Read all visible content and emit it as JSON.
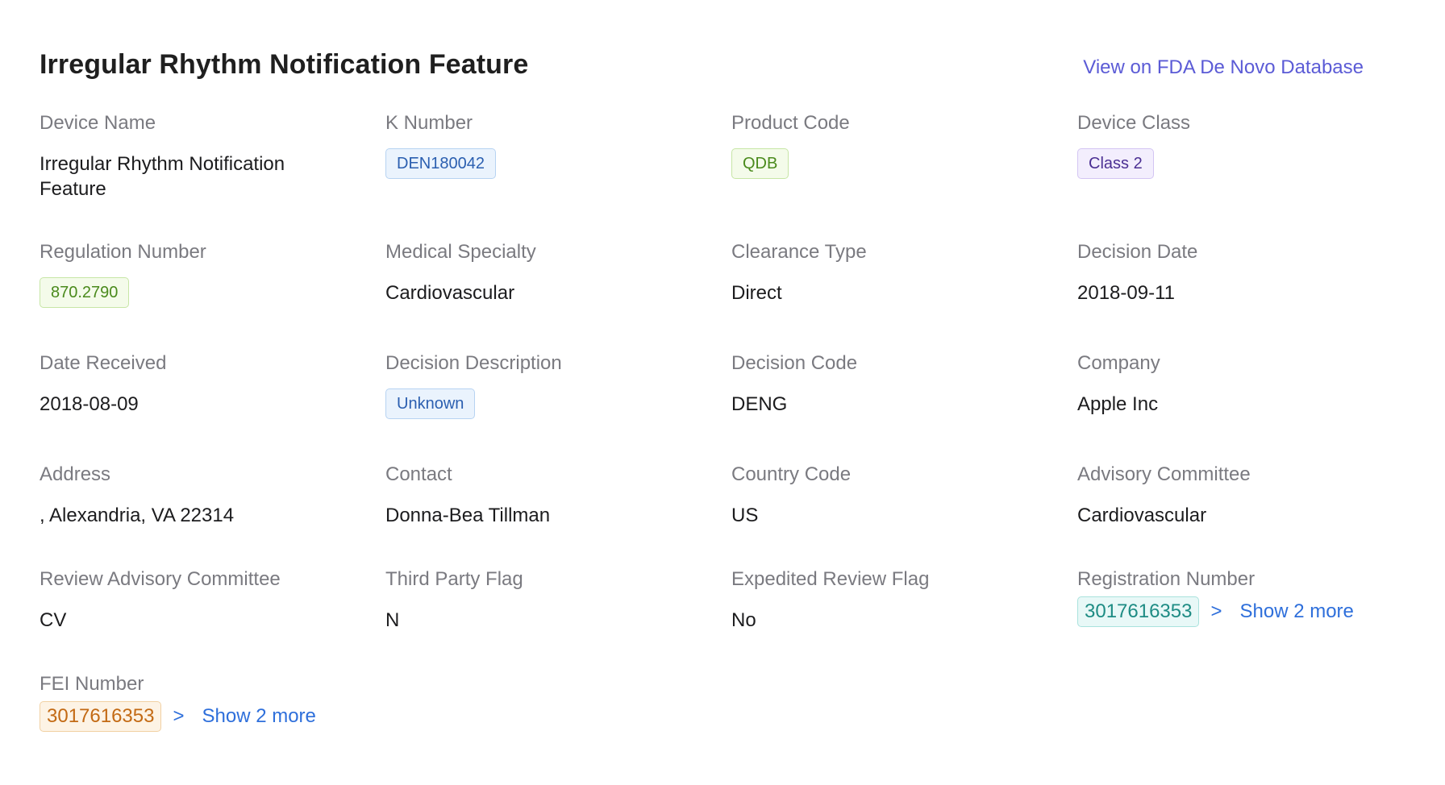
{
  "header": {
    "title": "Irregular Rhythm Notification Feature",
    "link_label": "View on FDA De Novo Database"
  },
  "fields": {
    "device_name": {
      "label": "Device Name",
      "value": "Irregular Rhythm Notification Feature"
    },
    "k_number": {
      "label": "K Number",
      "value": "DEN180042"
    },
    "product_code": {
      "label": "Product Code",
      "value": "QDB"
    },
    "device_class": {
      "label": "Device Class",
      "value": "Class 2"
    },
    "regulation_number": {
      "label": "Regulation Number",
      "value": "870.2790"
    },
    "medical_specialty": {
      "label": "Medical Specialty",
      "value": "Cardiovascular"
    },
    "clearance_type": {
      "label": "Clearance Type",
      "value": "Direct"
    },
    "decision_date": {
      "label": "Decision Date",
      "value": "2018-09-11"
    },
    "date_received": {
      "label": "Date Received",
      "value": "2018-08-09"
    },
    "decision_description": {
      "label": "Decision Description",
      "value": "Unknown"
    },
    "decision_code": {
      "label": "Decision Code",
      "value": "DENG"
    },
    "company": {
      "label": "Company",
      "value": "Apple Inc"
    },
    "address": {
      "label": "Address",
      "value": ", Alexandria, VA 22314"
    },
    "contact": {
      "label": "Contact",
      "value": "Donna-Bea Tillman"
    },
    "country_code": {
      "label": "Country Code",
      "value": "US"
    },
    "advisory_committee": {
      "label": "Advisory Committee",
      "value": "Cardiovascular"
    },
    "review_advisory_committee": {
      "label": "Review Advisory Committee",
      "value": "CV"
    },
    "third_party_flag": {
      "label": "Third Party Flag",
      "value": "N"
    },
    "expedited_review_flag": {
      "label": "Expedited Review Flag",
      "value": "No"
    },
    "registration_number": {
      "label": "Registration Number",
      "value": "3017616353",
      "more_label": "Show 2 more",
      "chevron": ">"
    },
    "fei_number": {
      "label": "FEI Number",
      "value": "3017616353",
      "more_label": "Show 2 more",
      "chevron": ">"
    }
  },
  "colors": {
    "link": "#5b5bd6",
    "label": "#7a7a80",
    "more_link": "#2e6fdb"
  }
}
